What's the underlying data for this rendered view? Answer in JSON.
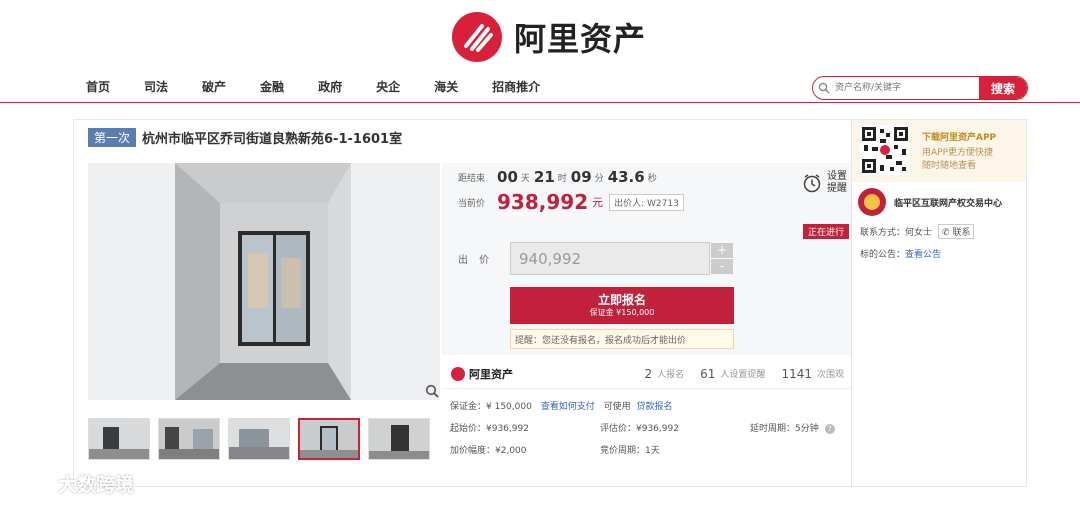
{
  "brand": {
    "name": "阿里资产",
    "color": "#d9203a"
  },
  "nav": [
    "首页",
    "司法",
    "破产",
    "金融",
    "政府",
    "央企",
    "海关",
    "招商推介"
  ],
  "search": {
    "placeholder": "资产名称/关键字",
    "button": "搜索",
    "icon": "search-icon"
  },
  "listing": {
    "round": "第一次",
    "title": "杭州市临平区乔司街道良熟新苑6-1-1601室",
    "countdown_label": "距结束",
    "countdown": {
      "days": "00",
      "day_unit": "天",
      "hours": "21",
      "hour_unit": "时",
      "minutes": "09",
      "minute_unit": "分",
      "seconds": "43.6",
      "second_unit": "秒"
    },
    "remind_label": "设置提醒",
    "current_price_label": "当前价",
    "current_price": "938,992",
    "price_unit": "元",
    "bidder": "出价人: W2713",
    "status": "正在进行",
    "offer_label": "出 价",
    "offer_value": "940,992",
    "plus": "+",
    "minus": "-",
    "signup_button": "立即报名",
    "signup_deposit": "保证金 ¥150,000",
    "hint": "提醒：您还没有报名，报名成功后才能出价"
  },
  "stats": {
    "brand": "阿里资产",
    "signups": "2",
    "signups_label": "人报名",
    "reminders": "61",
    "reminders_label": "人设置提醒",
    "views": "1141",
    "views_label": "次围观"
  },
  "info": {
    "deposit": "保证金：¥ 150,000",
    "pay_link": "查看如何支付",
    "usable": "可使用",
    "loan_link": "贷款报名",
    "start_price": "起始价：¥936,992",
    "assess_price": "评估价：¥936,992",
    "delay_period": "延时周期：5分钟",
    "increment": "加价幅度：¥2,000",
    "bid_period": "竞价周期：1天"
  },
  "side": {
    "app_title": "下载阿里资产APP",
    "app_line1": "用APP更方便快捷",
    "app_line2": "随时随地查看",
    "court": "临平区互联网产权交易中心",
    "contact_label": "联系方式：",
    "contact_name": "何女士",
    "contact_button": "联系",
    "notice_label": "标的公告：",
    "notice_link": "查看公告"
  },
  "watermark": "大数跨境",
  "colors": {
    "accent": "#c2213b",
    "link": "#3366cc",
    "round_badge": "#5b7db1"
  }
}
